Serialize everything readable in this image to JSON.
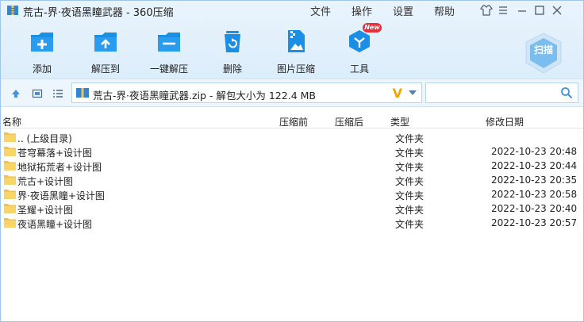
{
  "title": "荒古-界·夜语黑瞳武器 - 360压缩",
  "menu": [
    "文件",
    "操作",
    "设置",
    "帮助"
  ],
  "toolbar": {
    "add": "添加",
    "extract_to": "解压到",
    "one_click_extract": "一键解压",
    "delete": "删除",
    "image_compress": "图片压缩",
    "tools": "工具",
    "new_badge": "New",
    "scan": "扫描"
  },
  "address": {
    "text": "荒古-界·夜语黑瞳武器.zip - 解包大小为 122.4 MB",
    "search_placeholder": ""
  },
  "columns": {
    "name": "名称",
    "compressed_before": "压缩前",
    "compressed_after": "压缩后",
    "type": "类型",
    "modified": "修改日期"
  },
  "files": [
    {
      "name": ".. (上级目录)",
      "type": "文件夹",
      "date": ""
    },
    {
      "name": "苍穹幕落+设计图",
      "type": "文件夹",
      "date": "2022-10-23 20:48"
    },
    {
      "name": "地狱拓荒者+设计图",
      "type": "文件夹",
      "date": "2022-10-23 20:44"
    },
    {
      "name": "荒古+设计图",
      "type": "文件夹",
      "date": "2022-10-23 20:35"
    },
    {
      "name": "界·夜语黑瞳+设计图",
      "type": "文件夹",
      "date": "2022-10-23 20:58"
    },
    {
      "name": "圣耀+设计图",
      "type": "文件夹",
      "date": "2022-10-23 20:40"
    },
    {
      "name": "夜语黑瞳+设计图",
      "type": "文件夹",
      "date": "2022-10-23 20:57"
    }
  ],
  "colors": {
    "accent": "#1a8fe3",
    "folder": "#f5c242",
    "badge": "#e8303a",
    "scan": "#6fb7ee"
  }
}
